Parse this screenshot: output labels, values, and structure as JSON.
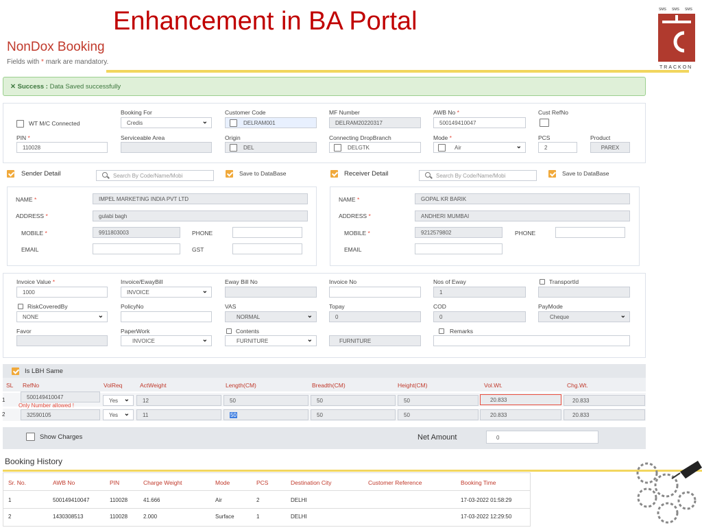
{
  "slide_title": "Enhancement in BA Portal",
  "form": {
    "title": "NonDox Booking",
    "mandatory_note_pre": "Fields with",
    "mandatory_star": "*",
    "mandatory_note_post": "mark are mandatory."
  },
  "logo": {
    "text_top": [
      "SMS",
      "SMS",
      "SMS"
    ],
    "text_bottom": "TRACKON"
  },
  "success": {
    "icon": "x-icon",
    "prefix": "Success :",
    "message": "Data Saved successfully"
  },
  "booking": {
    "wt_connected": "WT M/C Connected",
    "booking_for_label": "Booking For",
    "booking_for_value": "Credis",
    "customer_code_label": "Customer Code",
    "customer_code_value": "DELRAM001",
    "mf_number_label": "MF Number",
    "mf_number_value": "DELRAM20220317",
    "awb_label": "AWB No",
    "awb_value": "500149410047",
    "cust_ref_label": "Cust RefNo",
    "pin_label": "PIN",
    "pin_value": "110028",
    "serviceable_label": "Serviceable Area",
    "origin_label": "Origin",
    "origin_value": "DEL",
    "connecting_label": "Connecting DropBranch",
    "connecting_value": "DELGTK",
    "mode_label": "Mode",
    "mode_value": "Air",
    "pcs_label": "PCS",
    "pcs_value": "2",
    "product_label": "Product",
    "product_value": "PAREX"
  },
  "sender": {
    "title": "Sender Detail",
    "search_placeholder": "Search By Code/Name/Mobi",
    "save_db": "Save to DataBase",
    "name_label": "NAME",
    "name_value": "IMPEL MARKETING INDIA PVT LTD",
    "address_label": "ADDRESS",
    "address_value": "gulabi bagh",
    "mobile_label": "MOBILE",
    "mobile_value": "9911803003",
    "phone_label": "PHONE",
    "email_label": "EMAIL",
    "gst_label": "GST"
  },
  "receiver": {
    "title": "Receiver Detail",
    "search_placeholder": "Search By Code/Name/Mobi",
    "save_db": "Save to DataBase",
    "name_label": "NAME",
    "name_value": "GOPAL KR BARIK",
    "address_label": "ADDRESS",
    "address_value": "ANDHERI MUMBAI",
    "mobile_label": "MOBILE",
    "mobile_value": "9212579802",
    "phone_label": "PHONE",
    "email_label": "EMAIL"
  },
  "invoice": {
    "invoice_value_label": "Invoice Value",
    "invoice_value": "1000",
    "eway_label": "Invoice/EwayBill",
    "eway_value": "INVOICE",
    "eway_no_label": "Eway Bill No",
    "invoice_no_label": "Invoice No",
    "nos_eway_label": "Nos of Eway",
    "nos_eway_value": "1",
    "transport_label": "TransportId",
    "risk_label": "RiskCoveredBy",
    "risk_value": "NONE",
    "policy_label": "PolicyNo",
    "vas_label": "VAS",
    "vas_value": "NORMAL",
    "topay_label": "Topay",
    "topay_value": "0",
    "cod_label": "COD",
    "cod_value": "0",
    "paymode_label": "PayMode",
    "paymode_value": "Cheque",
    "favor_label": "Favor",
    "paperwork_label": "PaperWork",
    "paperwork_value": "INVOICE",
    "contents_label": "Contents",
    "contents_value": "FURNITURE",
    "contents_text": "FURNITURE",
    "remarks_label": "Remarks"
  },
  "lbh": {
    "title": "Is LBH Same",
    "headers": [
      "SL",
      "RefNo",
      "VolReq",
      "ActWeight",
      "Length(CM)",
      "Breadth(CM)",
      "Height(CM)",
      "Vol.Wt.",
      "Chg.Wt."
    ],
    "rows": [
      {
        "sl": "1",
        "ref": "500149410047",
        "volreq": "Yes",
        "act": "12",
        "len": "50",
        "br": "50",
        "ht": "50",
        "vol": "20.833",
        "chg": "20.833"
      },
      {
        "sl": "2",
        "ref": "32590105",
        "volreq": "Yes",
        "act": "11",
        "len": "50",
        "br": "50",
        "ht": "50",
        "vol": "20.833",
        "chg": "20.833"
      }
    ],
    "error": "Only Number allowed !"
  },
  "footer": {
    "show_charges": "Show Charges",
    "net_amount_label": "Net Amount",
    "net_amount_value": "0"
  },
  "history": {
    "title": "Booking History",
    "headers": [
      "Sr. No.",
      "AWB No",
      "PIN",
      "Charge Weight",
      "Mode",
      "PCS",
      "Destination City",
      "Customer Reference",
      "Booking Time"
    ],
    "rows": [
      [
        "1",
        "500149410047",
        "110028",
        "41.666",
        "Air",
        "2",
        "DELHI",
        "",
        "17-03-2022 01:58:29"
      ],
      [
        "2",
        "1430308513",
        "110028",
        "2.000",
        "Surface",
        "1",
        "DELHI",
        "",
        "17-03-2022 12:29:50"
      ]
    ]
  }
}
